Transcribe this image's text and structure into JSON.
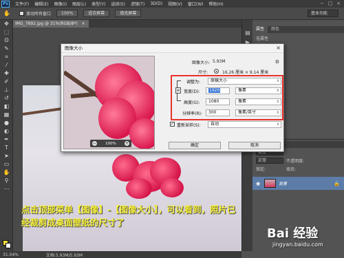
{
  "menubar": {
    "logo": "Ps",
    "items": [
      "文件(F)",
      "编辑(E)",
      "图像(I)",
      "图层(L)",
      "类型(Y)",
      "选择(S)",
      "滤镜(T)",
      "3D(D)",
      "视图(V)",
      "窗口(W)",
      "帮助(H)"
    ],
    "minimize": "−",
    "maximize": "□",
    "close": "×"
  },
  "options": {
    "tool_icon": "hand-icon",
    "scroll_all_label": "滚动所有窗口",
    "zoom_value": "100%",
    "fit_screen": "适合屏幕",
    "fill_screen": "填充屏幕",
    "workspace": "基本功能"
  },
  "document": {
    "tab_title": "IMG_7892.jpg @ 31%(RGB/8*)",
    "tab_close": "×"
  },
  "status": {
    "zoom": "31.04%",
    "doc_size": "文档:5.93M/5.93M"
  },
  "caption": {
    "line1": "点击顶部菜单【图像】-【图像大小】，可以看到，照片已",
    "line2": "经裁剪成桌面壁纸的尺寸了"
  },
  "panels": {
    "properties_tab": "属性",
    "color_tab": "颜色",
    "properties_empty": "无属性",
    "layers_title": "图层",
    "kind_filter": "类型",
    "blend_mode": "正常",
    "lock_label": "锁定:",
    "opacity_label": "不透明度:",
    "fill_label": "填充:",
    "layer_name": "背景"
  },
  "dialog": {
    "title": "图像大小",
    "close": "×",
    "image_size_label": "图像大小:",
    "image_size_value": "5.93M",
    "dimensions_label": "尺寸:",
    "dimensions_value": "16.26 厘米 × 9.14 厘米",
    "fit_to_label": "调整为:",
    "fit_to_value": "原稿大小",
    "width_label": "宽度(D):",
    "width_value": "1920",
    "width_unit": "像素",
    "height_label": "高度(G):",
    "height_value": "1080",
    "height_unit": "像素",
    "resolution_label": "分辨率(R):",
    "resolution_value": "300",
    "resolution_unit": "像素/英寸",
    "resample_label": "重新采样(S):",
    "resample_value": "自动",
    "ok": "确定",
    "cancel": "取消",
    "preview_zoom": "100%",
    "zoom_minus": "−",
    "zoom_plus": "+"
  },
  "watermark": {
    "logo": "Bai 经验",
    "url": "jingyan.baidu.com"
  },
  "colors": {
    "foreground": "#f5e33a",
    "background": "#ffffff",
    "highlight_box": "#e8312a",
    "caption_text": "#f6f03a"
  }
}
